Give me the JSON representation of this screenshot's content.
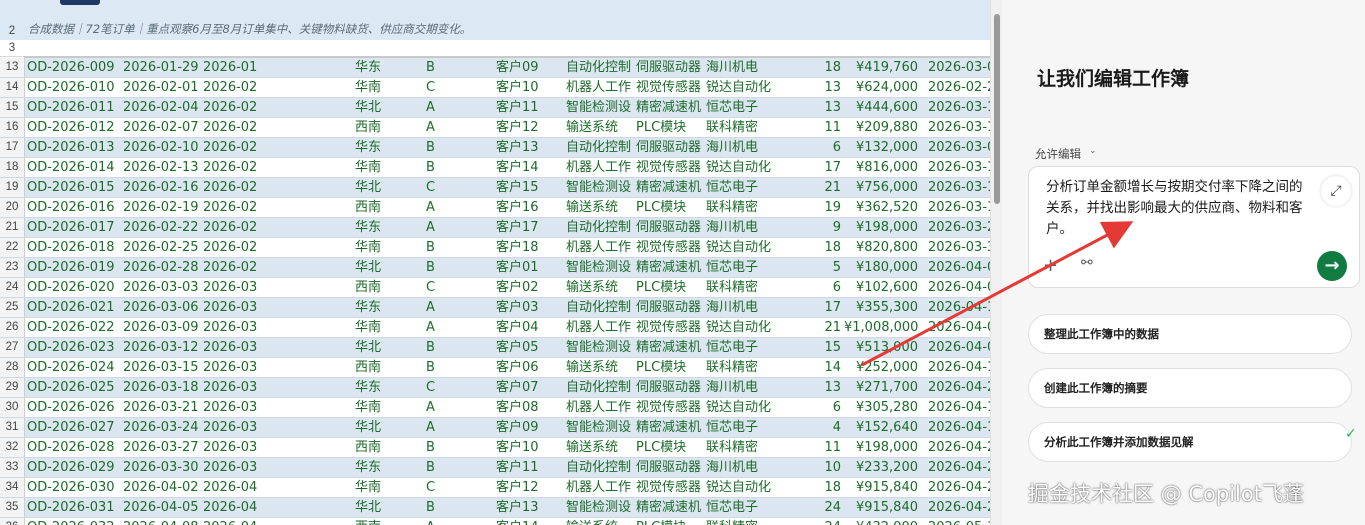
{
  "sheet": {
    "subtitle": "合成数据｜72笔订单｜重点观察6月至8月订单集中、关键物料缺货、供应商交期变化。",
    "header_rows": [
      "2",
      "3"
    ],
    "rows": [
      {
        "n": "13",
        "id": "OD-2026-009",
        "date": "2026-01-29",
        "ym": "2026-01",
        "region": "华东",
        "level": "B",
        "customer": "客户09",
        "category": "自动化控制",
        "material": "伺服驱动器",
        "supplier": "海川机电",
        "qty": "18",
        "amount": "¥419,760",
        "due": "2026-03-0"
      },
      {
        "n": "14",
        "id": "OD-2026-010",
        "date": "2026-02-01",
        "ym": "2026-02",
        "region": "华南",
        "level": "C",
        "customer": "客户10",
        "category": "机器人工作",
        "material": "视觉传感器",
        "supplier": "锐达自动化",
        "qty": "13",
        "amount": "¥624,000",
        "due": "2026-02-2"
      },
      {
        "n": "15",
        "id": "OD-2026-011",
        "date": "2026-02-04",
        "ym": "2026-02",
        "region": "华北",
        "level": "A",
        "customer": "客户11",
        "category": "智能检测设",
        "material": "精密减速机",
        "supplier": "恒芯电子",
        "qty": "13",
        "amount": "¥444,600",
        "due": "2026-03-1"
      },
      {
        "n": "16",
        "id": "OD-2026-012",
        "date": "2026-02-07",
        "ym": "2026-02",
        "region": "西南",
        "level": "A",
        "customer": "客户12",
        "category": "输送系统",
        "material": "PLC模块",
        "supplier": "联科精密",
        "qty": "11",
        "amount": "¥209,880",
        "due": "2026-03-1"
      },
      {
        "n": "17",
        "id": "OD-2026-013",
        "date": "2026-02-10",
        "ym": "2026-02",
        "region": "华东",
        "level": "B",
        "customer": "客户13",
        "category": "自动化控制",
        "material": "伺服驱动器",
        "supplier": "海川机电",
        "qty": "6",
        "amount": "¥132,000",
        "due": "2026-03-0"
      },
      {
        "n": "18",
        "id": "OD-2026-014",
        "date": "2026-02-13",
        "ym": "2026-02",
        "region": "华南",
        "level": "B",
        "customer": "客户14",
        "category": "机器人工作",
        "material": "视觉传感器",
        "supplier": "锐达自动化",
        "qty": "17",
        "amount": "¥816,000",
        "due": "2026-03-1"
      },
      {
        "n": "19",
        "id": "OD-2026-015",
        "date": "2026-02-16",
        "ym": "2026-02",
        "region": "华北",
        "level": "C",
        "customer": "客户15",
        "category": "智能检测设",
        "material": "精密减速机",
        "supplier": "恒芯电子",
        "qty": "21",
        "amount": "¥756,000",
        "due": "2026-03-1"
      },
      {
        "n": "20",
        "id": "OD-2026-016",
        "date": "2026-02-19",
        "ym": "2026-02",
        "region": "西南",
        "level": "A",
        "customer": "客户16",
        "category": "输送系统",
        "material": "PLC模块",
        "supplier": "联科精密",
        "qty": "19",
        "amount": "¥362,520",
        "due": "2026-03-1"
      },
      {
        "n": "21",
        "id": "OD-2026-017",
        "date": "2026-02-22",
        "ym": "2026-02",
        "region": "华东",
        "level": "A",
        "customer": "客户17",
        "category": "自动化控制",
        "material": "伺服驱动器",
        "supplier": "海川机电",
        "qty": "9",
        "amount": "¥198,000",
        "due": "2026-03-2"
      },
      {
        "n": "22",
        "id": "OD-2026-018",
        "date": "2026-02-25",
        "ym": "2026-02",
        "region": "华南",
        "level": "B",
        "customer": "客户18",
        "category": "机器人工作",
        "material": "视觉传感器",
        "supplier": "锐达自动化",
        "qty": "18",
        "amount": "¥820,800",
        "due": "2026-03-3"
      },
      {
        "n": "23",
        "id": "OD-2026-019",
        "date": "2026-02-28",
        "ym": "2026-02",
        "region": "华北",
        "level": "B",
        "customer": "客户01",
        "category": "智能检测设",
        "material": "精密减速机",
        "supplier": "恒芯电子",
        "qty": "5",
        "amount": "¥180,000",
        "due": "2026-04-0"
      },
      {
        "n": "24",
        "id": "OD-2026-020",
        "date": "2026-03-03",
        "ym": "2026-03",
        "region": "西南",
        "level": "C",
        "customer": "客户02",
        "category": "输送系统",
        "material": "PLC模块",
        "supplier": "联科精密",
        "qty": "6",
        "amount": "¥102,600",
        "due": "2026-04-0"
      },
      {
        "n": "25",
        "id": "OD-2026-021",
        "date": "2026-03-06",
        "ym": "2026-03",
        "region": "华东",
        "level": "A",
        "customer": "客户03",
        "category": "自动化控制",
        "material": "伺服驱动器",
        "supplier": "海川机电",
        "qty": "17",
        "amount": "¥355,300",
        "due": "2026-04-1"
      },
      {
        "n": "26",
        "id": "OD-2026-022",
        "date": "2026-03-09",
        "ym": "2026-03",
        "region": "华南",
        "level": "A",
        "customer": "客户04",
        "category": "机器人工作",
        "material": "视觉传感器",
        "supplier": "锐达自动化",
        "qty": "21",
        "amount": "¥1,008,000",
        "due": "2026-04-0"
      },
      {
        "n": "27",
        "id": "OD-2026-023",
        "date": "2026-03-12",
        "ym": "2026-03",
        "region": "华北",
        "level": "B",
        "customer": "客户05",
        "category": "智能检测设",
        "material": "精密减速机",
        "supplier": "恒芯电子",
        "qty": "15",
        "amount": "¥513,000",
        "due": "2026-04-0"
      },
      {
        "n": "28",
        "id": "OD-2026-024",
        "date": "2026-03-15",
        "ym": "2026-03",
        "region": "西南",
        "level": "B",
        "customer": "客户06",
        "category": "输送系统",
        "material": "PLC模块",
        "supplier": "联科精密",
        "qty": "14",
        "amount": "¥252,000",
        "due": "2026-04-1"
      },
      {
        "n": "29",
        "id": "OD-2026-025",
        "date": "2026-03-18",
        "ym": "2026-03",
        "region": "华东",
        "level": "C",
        "customer": "客户07",
        "category": "自动化控制",
        "material": "伺服驱动器",
        "supplier": "海川机电",
        "qty": "13",
        "amount": "¥271,700",
        "due": "2026-04-2"
      },
      {
        "n": "30",
        "id": "OD-2026-026",
        "date": "2026-03-21",
        "ym": "2026-03",
        "region": "华南",
        "level": "A",
        "customer": "客户08",
        "category": "机器人工作",
        "material": "视觉传感器",
        "supplier": "锐达自动化",
        "qty": "6",
        "amount": "¥305,280",
        "due": "2026-04-1"
      },
      {
        "n": "31",
        "id": "OD-2026-027",
        "date": "2026-03-24",
        "ym": "2026-03",
        "region": "华北",
        "level": "A",
        "customer": "客户09",
        "category": "智能检测设",
        "material": "精密减速机",
        "supplier": "恒芯电子",
        "qty": "4",
        "amount": "¥152,640",
        "due": "2026-04-1"
      },
      {
        "n": "32",
        "id": "OD-2026-028",
        "date": "2026-03-27",
        "ym": "2026-03",
        "region": "西南",
        "level": "B",
        "customer": "客户10",
        "category": "输送系统",
        "material": "PLC模块",
        "supplier": "联科精密",
        "qty": "11",
        "amount": "¥198,000",
        "due": "2026-04-2"
      },
      {
        "n": "33",
        "id": "OD-2026-029",
        "date": "2026-03-30",
        "ym": "2026-03",
        "region": "华东",
        "level": "B",
        "customer": "客户11",
        "category": "自动化控制",
        "material": "伺服驱动器",
        "supplier": "海川机电",
        "qty": "10",
        "amount": "¥233,200",
        "due": "2026-04-2"
      },
      {
        "n": "34",
        "id": "OD-2026-030",
        "date": "2026-04-02",
        "ym": "2026-04",
        "region": "华南",
        "level": "C",
        "customer": "客户12",
        "category": "机器人工作",
        "material": "视觉传感器",
        "supplier": "锐达自动化",
        "qty": "18",
        "amount": "¥915,840",
        "due": "2026-04-2"
      },
      {
        "n": "35",
        "id": "OD-2026-031",
        "date": "2026-04-05",
        "ym": "2026-04",
        "region": "华北",
        "level": "B",
        "customer": "客户13",
        "category": "智能检测设",
        "material": "精密减速机",
        "supplier": "恒芯电子",
        "qty": "24",
        "amount": "¥915,840",
        "due": "2026-04-2"
      },
      {
        "n": "36",
        "id": "OD-2026-032",
        "date": "2026-04-08",
        "ym": "2026-04",
        "region": "西南",
        "level": "A",
        "customer": "客户14",
        "category": "输送系统",
        "material": "PLC模块",
        "supplier": "联科精密",
        "qty": "24",
        "amount": "¥432,000",
        "due": "2026-05-1"
      }
    ]
  },
  "copilot": {
    "title": "让我们编辑工作簿",
    "permission_label": "允许编辑",
    "prompt_text": "分析订单金额增长与按期交付率下降之间的关系，并找出影响最大的供应商、物料和客户。",
    "suggestions": [
      "整理此工作簿中的数据",
      "创建此工作簿的摘要",
      "分析此工作簿并添加数据见解"
    ],
    "icons": {
      "expand": "expand-icon",
      "add": "plus-icon",
      "attach": "link-icon",
      "send": "send-arrow-icon",
      "logo": "copilot-logo-icon"
    },
    "accent_color": "#107c41"
  },
  "watermark": "掘金技术社区 @ Copilot飞蓬",
  "annotation": {
    "arrow_color": "#e53935"
  }
}
